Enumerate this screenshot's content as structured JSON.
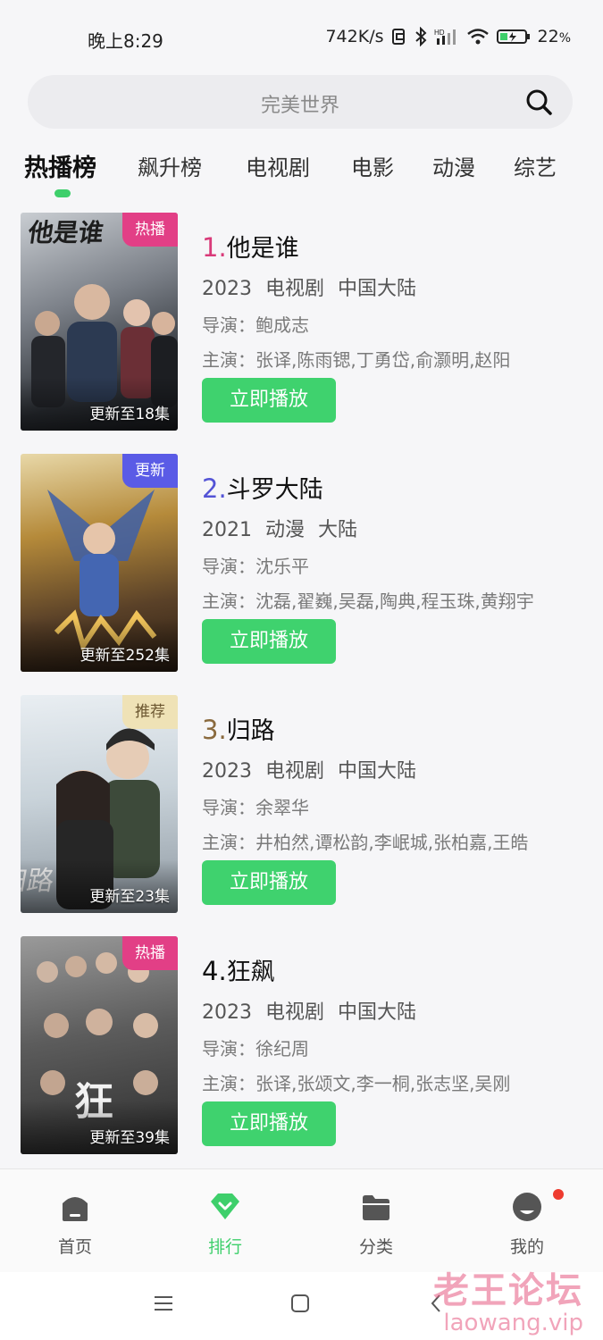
{
  "status_bar": {
    "time": "晚上8:29",
    "net_speed": "742K/s",
    "battery": "22",
    "battery_unit": "%"
  },
  "search": {
    "placeholder": "完美世界"
  },
  "tabs": [
    {
      "label": "热播榜",
      "active": true
    },
    {
      "label": "飙升榜"
    },
    {
      "label": "电视剧"
    },
    {
      "label": "电影"
    },
    {
      "label": "动漫"
    },
    {
      "label": "综艺"
    }
  ],
  "items": [
    {
      "rank": "1.",
      "rank_color": "#d93a79",
      "title": "他是谁",
      "year": "2023",
      "type": "电视剧",
      "region": "中国大陆",
      "director": "导演：鲍成志",
      "cast": "主演：张译,陈雨锶,丁勇岱,俞灏明,赵阳",
      "tag": "热播",
      "tag_bg": "#e23f86",
      "tag_color": "#ffffff",
      "update": "更新至18集",
      "play_label": "立即播放"
    },
    {
      "rank": "2.",
      "rank_color": "#5353d6",
      "title": "斗罗大陆",
      "year": "2021",
      "type": "动漫",
      "region": "大陆",
      "director": "导演：沈乐平",
      "cast": "主演：沈磊,翟巍,吴磊,陶典,程玉珠,黄翔宇",
      "tag": "更新",
      "tag_bg": "#5a5be6",
      "tag_color": "#ffffff",
      "update": "更新至252集",
      "play_label": "立即播放"
    },
    {
      "rank": "3.",
      "rank_color": "#8a6a3e",
      "title": "归路",
      "year": "2023",
      "type": "电视剧",
      "region": "中国大陆",
      "director": "导演：余翠华",
      "cast": "主演：井柏然,谭松韵,李岷城,张柏嘉,王皓",
      "tag": "推荐",
      "tag_bg": "#efe2b6",
      "tag_color": "#6b5630",
      "update": "更新至23集",
      "play_label": "立即播放"
    },
    {
      "rank": "4.",
      "rank_color": "#111111",
      "title": "狂飙",
      "year": "2023",
      "type": "电视剧",
      "region": "中国大陆",
      "director": "导演：徐纪周",
      "cast": "主演：张译,张颂文,李一桐,张志坚,吴刚",
      "tag": "热播",
      "tag_bg": "#e23f86",
      "tag_color": "#ffffff",
      "update": "更新至39集",
      "play_label": "立即播放"
    }
  ],
  "bottom_nav": [
    {
      "label": "首页",
      "icon": "home-icon"
    },
    {
      "label": "排行",
      "icon": "ranking-icon",
      "active": true
    },
    {
      "label": "分类",
      "icon": "folder-icon"
    },
    {
      "label": "我的",
      "icon": "profile-icon",
      "badge": true
    }
  ],
  "system_nav": [
    "menu-icon",
    "home-square-icon",
    "back-icon"
  ],
  "watermark": {
    "cn": "老王论坛",
    "en": "laowang.vip"
  },
  "colors": {
    "accent": "#3fd26e",
    "badge": "#ee3b2f"
  }
}
